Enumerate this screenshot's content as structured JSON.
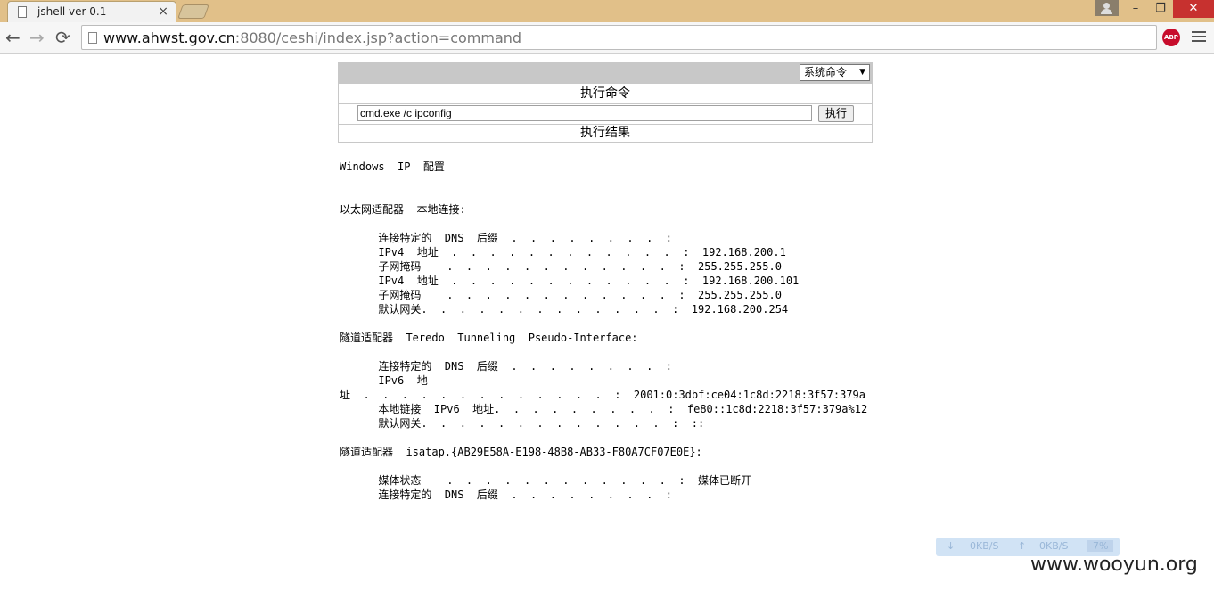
{
  "browser": {
    "tab_title": "jshell ver 0.1",
    "tab_close": "×",
    "url_host": "www.ahwst.gov.cn",
    "url_rest": ":8080/ceshi/index.jsp?action=command",
    "back": "←",
    "forward": "→",
    "reload": "⟳",
    "star": "☆",
    "abp": "ABP",
    "win_minimize": "–",
    "win_maximize": "❐",
    "win_close": "✕"
  },
  "panel": {
    "select_value": "系统命令",
    "exec_label": "执行命令",
    "command_value": "cmd.exe /c ipconfig",
    "run_button": "执行",
    "result_label": "执行结果"
  },
  "output_lines": [
    "Windows  IP  配置",
    "",
    "",
    "以太网适配器  本地连接:",
    "",
    "      连接特定的  DNS  后缀  .  .  .  .  .  .  .  .  :",
    "      IPv4  地址  .  .  .  .  .  .  .  .  .  .  .  .  :  192.168.200.1",
    "      子网掩码    .  .  .  .  .  .  .  .  .  .  .  .  :  255.255.255.0",
    "      IPv4  地址  .  .  .  .  .  .  .  .  .  .  .  .  :  192.168.200.101",
    "      子网掩码    .  .  .  .  .  .  .  .  .  .  .  .  :  255.255.255.0",
    "      默认网关.  .  .  .  .  .  .  .  .  .  .  .  .  :  192.168.200.254",
    "",
    "隧道适配器  Teredo  Tunneling  Pseudo-Interface:",
    "",
    "      连接特定的  DNS  后缀  .  .  .  .  .  .  .  .  :",
    "      IPv6  地",
    "址  .  .  .  .  .  .  .  .  .  .  .  .  .  :  2001:0:3dbf:ce04:1c8d:2218:3f57:379a",
    "      本地链接  IPv6  地址.  .  .  .  .  .  .  .  .  :  fe80::1c8d:2218:3f57:379a%12",
    "      默认网关.  .  .  .  .  .  .  .  .  .  .  .  .  :  ::",
    "",
    "隧道适配器  isatap.{AB29E58A-E198-48B8-AB33-F80A7CF07E0E}:",
    "",
    "      媒体状态    .  .  .  .  .  .  .  .  .  .  .  .  :  媒体已断开",
    "      连接特定的  DNS  后缀  .  .  .  .  .  .  .  .  :"
  ],
  "netmon": {
    "down_icon": "↓",
    "down": "0KB/S",
    "up_icon": "↑",
    "up": "0KB/S",
    "cpu": "7%"
  },
  "watermark": "www.wooyun.org"
}
